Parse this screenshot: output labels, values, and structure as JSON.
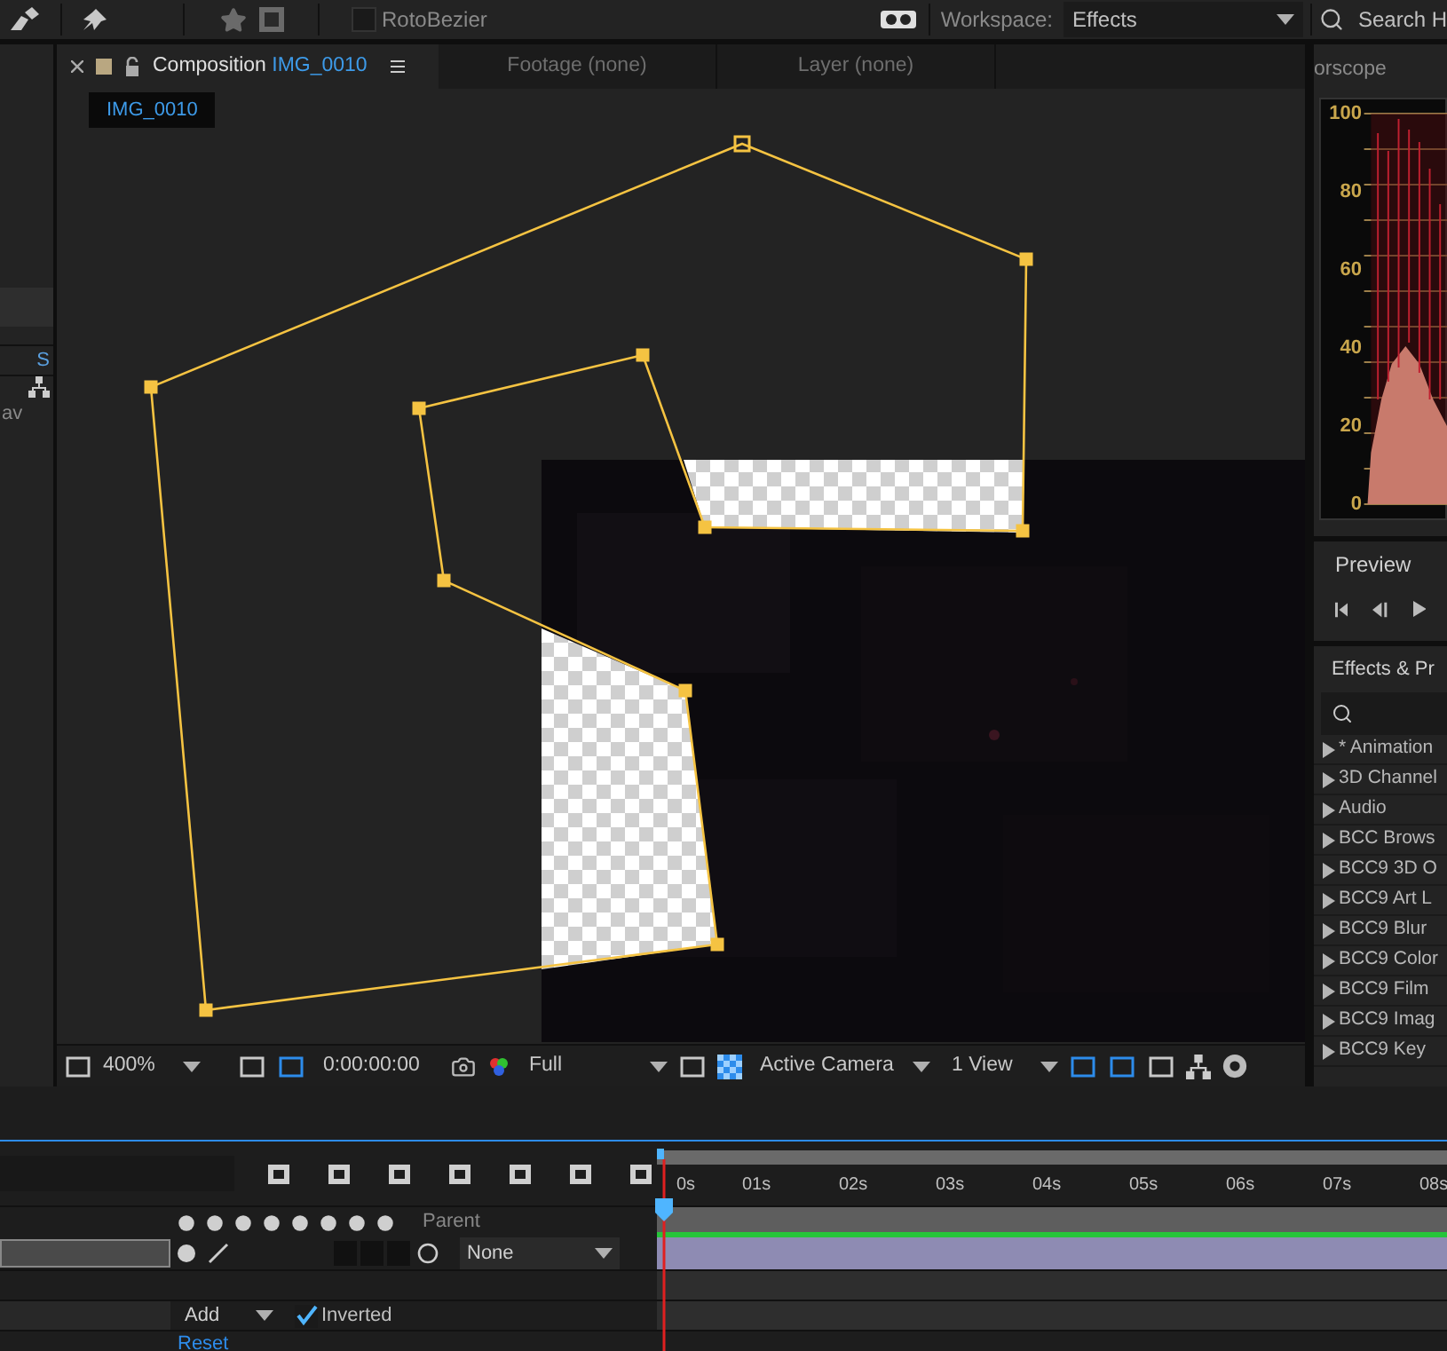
{
  "toolbar": {
    "rotobezier": {
      "label": "RotoBezier",
      "checked": false
    },
    "workspace_label": "Workspace:",
    "workspace": "Effects",
    "search": "Search H"
  },
  "left_panel": {
    "texts": [
      "S",
      "av"
    ]
  },
  "composition_panel": {
    "tabs": [
      {
        "prefix": "Composition",
        "label": "IMG_0010",
        "selected": true
      },
      {
        "label": "Footage (none)",
        "selected": false
      },
      {
        "label": "Layer (none)",
        "selected": false
      }
    ],
    "breadcrumb": "IMG_0010",
    "footer": {
      "zoom": "400%",
      "timecode": "0:00:00:00",
      "resolution": "Full",
      "camera": "Active Camera",
      "views": "1 View"
    }
  },
  "scope_panel": {
    "tab": "orscope",
    "ticks": [
      "100",
      "80",
      "60",
      "40",
      "20",
      "0"
    ]
  },
  "preview_panel": {
    "title": "Preview"
  },
  "effects_panel": {
    "title": "Effects & Pr",
    "items": [
      "* Animation",
      "3D Channel",
      "Audio",
      "BCC Brows",
      "BCC9 3D O",
      "BCC9 Art L",
      "BCC9 Blur",
      "BCC9 Color",
      "BCC9 Film",
      "BCC9 Imag",
      "BCC9 Key"
    ]
  },
  "timeline": {
    "ruler": [
      "0s",
      "01s",
      "02s",
      "03s",
      "04s",
      "05s",
      "06s",
      "07s",
      "08s"
    ],
    "parent_label": "Parent",
    "layer_parent": "None",
    "mask": {
      "mode": "Add",
      "inverted": true,
      "label": "Inverted"
    },
    "reset": "Reset"
  }
}
